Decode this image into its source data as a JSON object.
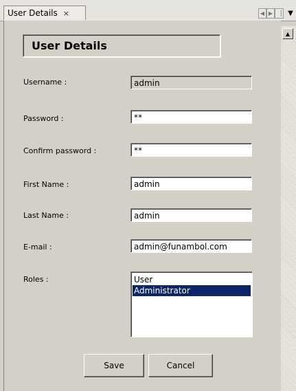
{
  "tab": {
    "title": "User Details",
    "close": "×"
  },
  "header": {
    "title": "User Details"
  },
  "form": {
    "username": {
      "label": "Username :",
      "value": "admin"
    },
    "password": {
      "label": "Password :",
      "value": "**"
    },
    "confirm_password": {
      "label": "Confirm password :",
      "value": "**"
    },
    "first_name": {
      "label": "First Name :",
      "value": "admin"
    },
    "last_name": {
      "label": "Last Name :",
      "value": "admin"
    },
    "email": {
      "label": "E-mail :",
      "value": "admin@funambol.com"
    },
    "roles": {
      "label": "Roles :",
      "options": [
        "User",
        "Administrator"
      ],
      "selected": "Administrator"
    }
  },
  "buttons": {
    "save": "Save",
    "cancel": "Cancel"
  },
  "icons": {
    "tab_prev": "arrow-left-icon",
    "tab_next": "arrow-right-icon",
    "menu": "chevron-down-icon",
    "scroll_up": "arrow-up-icon"
  }
}
